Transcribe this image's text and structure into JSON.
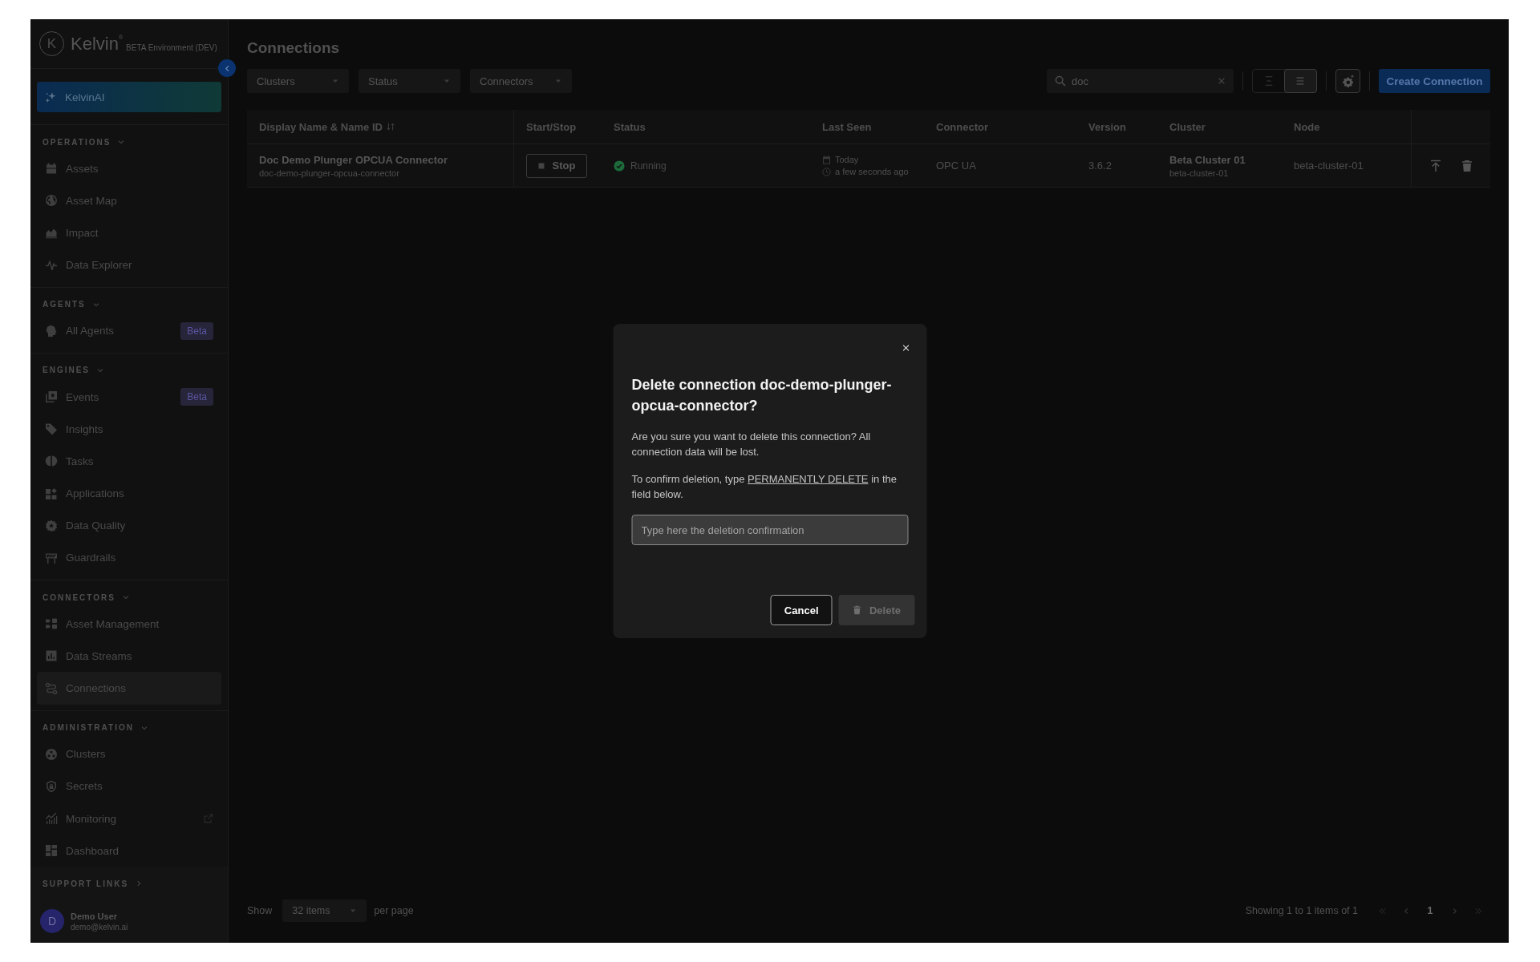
{
  "sidebar": {
    "logo": {
      "mark": "K",
      "name": "Kelvin$^{®}$",
      "environment": "BETA Environment (DEV)"
    },
    "ai_button": {
      "label": "KelvinAI"
    },
    "sections": [
      {
        "title": "OPERATIONS",
        "expanded": true,
        "items": [
          {
            "label": "Assets",
            "kind": "link",
            "selected": false
          },
          {
            "label": "Asset Map",
            "kind": "link",
            "selected": false
          },
          {
            "label": "Impact",
            "kind": "link",
            "selected": false
          },
          {
            "label": "Data Explorer",
            "kind": "link",
            "selected": false
          }
        ]
      },
      {
        "title": "AGENTS",
        "expanded": true,
        "items": [
          {
            "label": "All Agents",
            "kind": "link",
            "badge": "Beta",
            "selected": false
          }
        ]
      },
      {
        "title": "ENGINES",
        "expanded": true,
        "items": [
          {
            "label": "Events",
            "kind": "link",
            "badge": "Beta",
            "selected": false
          },
          {
            "label": "Insights",
            "kind": "link",
            "selected": false
          },
          {
            "label": "Tasks",
            "kind": "link",
            "selected": false
          },
          {
            "label": "Applications",
            "kind": "link",
            "selected": false
          },
          {
            "label": "Data Quality",
            "kind": "link",
            "selected": false
          },
          {
            "label": "Guardrails",
            "kind": "link",
            "selected": false
          }
        ]
      },
      {
        "title": "CONNECTORS",
        "expanded": true,
        "items": [
          {
            "label": "Asset Management",
            "kind": "link",
            "selected": false
          },
          {
            "label": "Data Streams",
            "kind": "link",
            "selected": false
          },
          {
            "label": "Connections",
            "kind": "link",
            "selected": true
          }
        ]
      },
      {
        "title": "ADMINISTRATION",
        "expanded": true,
        "items": [
          {
            "label": "Clusters",
            "kind": "link",
            "selected": false
          },
          {
            "label": "Secrets",
            "kind": "link",
            "selected": false
          },
          {
            "label": "Monitoring",
            "kind": "external",
            "selected": false
          },
          {
            "label": "Dashboard",
            "kind": "link",
            "selected": false
          }
        ]
      }
    ],
    "support": {
      "title": "SUPPORT LINKS",
      "expanded": false
    },
    "user": {
      "initial": "D",
      "name": "Demo User",
      "email": "demo@kelvin.ai"
    }
  },
  "page": {
    "title": "Connections",
    "filters": [
      {
        "placeholder": "Clusters"
      },
      {
        "placeholder": "Status"
      },
      {
        "placeholder": "Connectors"
      }
    ],
    "search": {
      "value": "doc"
    },
    "view_modes": [
      {
        "selected": false
      },
      {
        "selected": true
      }
    ],
    "create_button": "Create Connection"
  },
  "table": {
    "columns": [
      "Display Name & Name ID",
      "Start/Stop",
      "Status",
      "Last Seen",
      "Connector",
      "Version",
      "Cluster",
      "Node"
    ],
    "rows": [
      {
        "name": "Doc Demo Plunger OPCUA Connector",
        "name_id": "doc-demo-plunger-opcua-connector",
        "action": "Stop",
        "status": "Running",
        "last_seen_date": "Today",
        "last_seen_time": "a few seconds ago",
        "connector": "OPC UA",
        "version": "3.6.2",
        "cluster": "Beta Cluster 01",
        "cluster_id": "beta-cluster-01",
        "node": "beta-cluster-01"
      }
    ]
  },
  "pagination": {
    "show_label": "Show",
    "page_size": "32 items",
    "per_page_label": "per page",
    "summary": "Showing 1 to 1 items of 1",
    "pages": [
      {
        "label": "1",
        "selected": true
      }
    ]
  },
  "dialog": {
    "title": "Delete connection doc-demo-plunger-opcua-connector?",
    "message": "Are you sure you want to delete this connection? All connection data will be lost.",
    "instruction": {
      "before": "To confirm deletion, type",
      "keyword": "PERMANENTLY DELETE",
      "after": "in the field below."
    },
    "input": {
      "placeholder": "Type here the deletion confirmation"
    },
    "buttons": [
      {
        "label": "Cancel",
        "kind": "secondary",
        "disabled": false
      },
      {
        "label": "Delete",
        "kind": "danger",
        "disabled": true
      }
    ]
  }
}
